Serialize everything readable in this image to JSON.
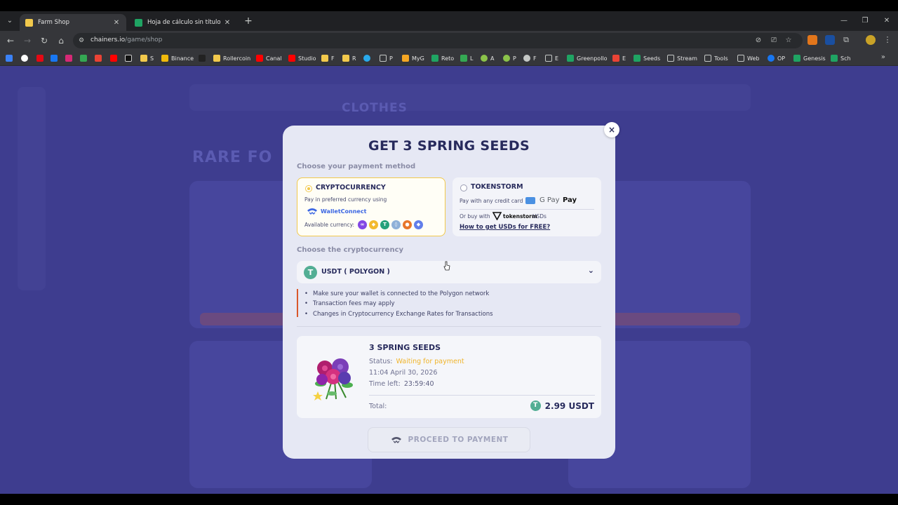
{
  "browser": {
    "tabs": [
      {
        "title": "Farm Shop",
        "active": true
      },
      {
        "title": "Hoja de cálculo sin título - Hoja",
        "active": false
      }
    ],
    "url": {
      "host": "chainers.io",
      "path": "/game/shop"
    },
    "bookmarks": [
      "",
      "",
      "",
      "",
      "",
      "",
      "",
      "",
      "",
      "S",
      "Binance",
      "",
      "Rollercoin",
      "Canal",
      "Studio",
      "F",
      "R",
      "",
      "P",
      "MyG",
      "Reto",
      "L",
      "A",
      "P",
      "F",
      "E",
      "Greenpollo",
      "E",
      "Seeds",
      "Stream",
      "Tools",
      "Web",
      "OP",
      "Genesis",
      "Sch"
    ]
  },
  "background": {
    "title_clothes": "CLOTHES",
    "title_rare": "RARE FO"
  },
  "modal": {
    "title": "GET 3 SPRING SEEDS",
    "close": "×",
    "payment_label": "Choose your payment method",
    "crypto": {
      "title": "CRYPTOCURRENCY",
      "desc": "Pay in preferred currency using",
      "walletconnect": "WalletConnect",
      "available": "Available currency:"
    },
    "tokenstorm": {
      "title": "TOKENSTORM",
      "desc": "Pay with any credit card",
      "gpay": "G Pay",
      "applepay": "Pay",
      "or_buy": "Or buy with",
      "brand": "tokenstorm",
      "usds": "USDs",
      "link": "How to get USDs for FREE?"
    },
    "crypto_label": "Choose the cryptocurrency",
    "selected_currency": "USDT  ( POLYGON )",
    "notes": [
      "Make sure your wallet is connected to the Polygon network",
      "Transaction fees may apply",
      "Changes in Cryptocurrency Exchange Rates for Transactions"
    ],
    "order": {
      "title": "3 SPRING SEEDS",
      "status_label": "Status:",
      "status_value": "Waiting for payment",
      "datetime": "11:04 April 30, 2026",
      "time_left_label": "Time left:",
      "time_left_value": "23:59:40",
      "total_label": "Total:",
      "total_value": "2.99 USDT"
    },
    "proceed_label": "PROCEED TO PAYMENT"
  }
}
